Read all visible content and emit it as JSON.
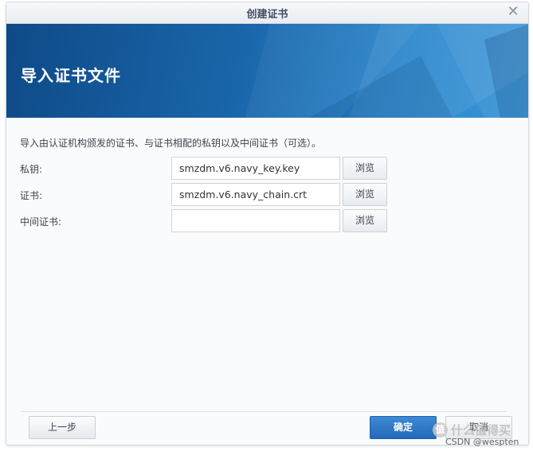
{
  "dialog": {
    "title": "创建证书",
    "close_glyph": "✕",
    "heading": "导入证书文件",
    "description": "导入由认证机构颁发的证书、与证书相配的私钥以及中间证书（可选）。",
    "fields": [
      {
        "label": "私钥:",
        "value": "smzdm.v6.navy_key.key",
        "browse_label": "浏览"
      },
      {
        "label": "证书:",
        "value": "smzdm.v6.navy_chain.crt",
        "browse_label": "浏览"
      },
      {
        "label": "中间证书:",
        "value": "",
        "browse_label": "浏览"
      }
    ],
    "buttons": {
      "prev": "上一步",
      "ok": "确定",
      "cancel": "取消"
    }
  },
  "watermark": {
    "logo_glyph": "值",
    "site_text": "什么值得买",
    "csdn_text": "CSDN @wespten"
  },
  "colors": {
    "banner": "#1a66ab",
    "primary_button": "#2d74c4",
    "title_text": "#3f4e63"
  }
}
